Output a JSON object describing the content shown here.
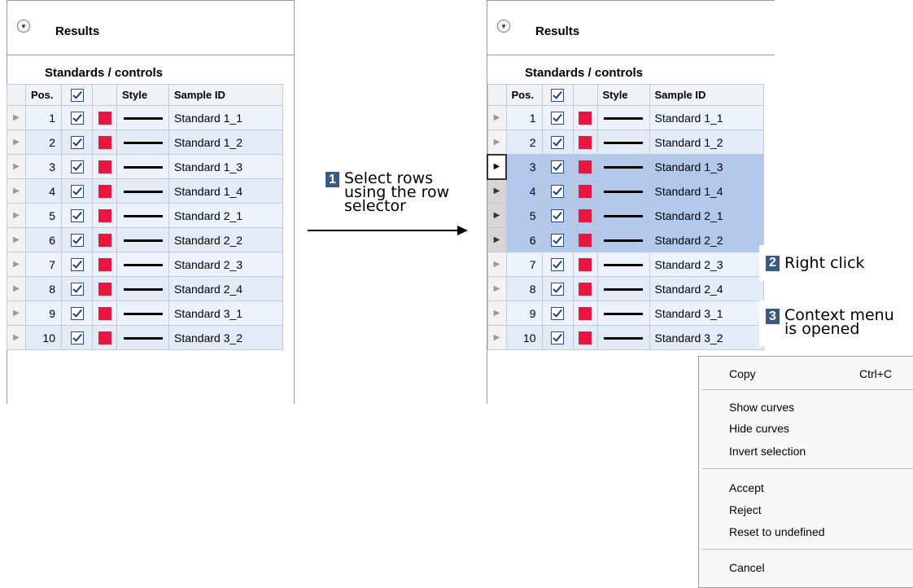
{
  "panel_left": {
    "title": "Results",
    "section": "Standards / controls",
    "columns": [
      "Pos.",
      "",
      "",
      "Style",
      "Sample ID"
    ],
    "rows": [
      {
        "pos": "1",
        "id": "Standard 1_1"
      },
      {
        "pos": "2",
        "id": "Standard 1_2"
      },
      {
        "pos": "3",
        "id": "Standard 1_3"
      },
      {
        "pos": "4",
        "id": "Standard 1_4"
      },
      {
        "pos": "5",
        "id": "Standard 2_1"
      },
      {
        "pos": "6",
        "id": "Standard 2_2"
      },
      {
        "pos": "7",
        "id": "Standard 2_3"
      },
      {
        "pos": "8",
        "id": "Standard 2_4"
      },
      {
        "pos": "9",
        "id": "Standard 3_1"
      },
      {
        "pos": "10",
        "id": "Standard 3_2"
      }
    ]
  },
  "panel_right": {
    "title": "Results",
    "section": "Standards / controls",
    "columns": [
      "Pos.",
      "",
      "",
      "Style",
      "Sample ID"
    ],
    "rows": [
      {
        "pos": "1",
        "id": "Standard 1_1"
      },
      {
        "pos": "2",
        "id": "Standard 1_2"
      },
      {
        "pos": "3",
        "id": "Standard 1_3"
      },
      {
        "pos": "4",
        "id": "Standard 1_4"
      },
      {
        "pos": "5",
        "id": "Standard 2_1"
      },
      {
        "pos": "6",
        "id": "Standard 2_2"
      },
      {
        "pos": "7",
        "id": "Standard 2_3"
      },
      {
        "pos": "8",
        "id": "Standard 2_4"
      },
      {
        "pos": "9",
        "id": "Standard 3_1"
      },
      {
        "pos": "10",
        "id": "Standard 3_2"
      }
    ],
    "selected_positions": [
      "3",
      "4",
      "5",
      "6"
    ]
  },
  "swatch_color": "#e8173f",
  "callouts": {
    "step1": {
      "num": "1",
      "line1": "Select rows",
      "line2": "using the row",
      "line3": "selector"
    },
    "step2": {
      "num": "2",
      "text": "Right click"
    },
    "step3": {
      "num": "3",
      "line1": "Context menu",
      "line2": "is opened"
    }
  },
  "context_menu": {
    "copy": "Copy",
    "copy_shortcut": "Ctrl+C",
    "show_curves": "Show curves",
    "hide_curves": "Hide curves",
    "invert_selection": "Invert selection",
    "accept": "Accept",
    "reject": "Reject",
    "reset": "Reset to undefined",
    "cancel": "Cancel"
  }
}
